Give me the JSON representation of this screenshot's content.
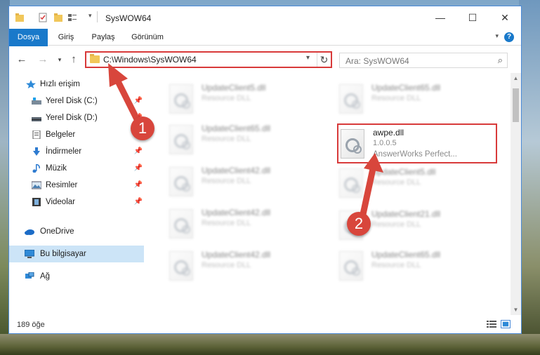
{
  "window": {
    "title": "SysWOW64",
    "minimize_icon": "minimize-icon",
    "maximize_icon": "maximize-icon",
    "close_icon": "close-icon"
  },
  "ribbon": {
    "tabs": [
      "Dosya",
      "Giriş",
      "Paylaş",
      "Görünüm"
    ],
    "help_label": "?"
  },
  "address_bar": {
    "path": "C:\\Windows\\SysWOW64",
    "search_placeholder": "Ara: SysWOW64"
  },
  "sidebar": {
    "items": [
      {
        "label": "Hızlı erişim",
        "icon": "star-icon"
      },
      {
        "label": "Yerel Disk (C:)",
        "icon": "drive-icon"
      },
      {
        "label": "Yerel Disk (D:)",
        "icon": "drive-icon"
      },
      {
        "label": "Belgeler",
        "icon": "documents-icon"
      },
      {
        "label": "İndirmeler",
        "icon": "download-icon"
      },
      {
        "label": "Müzik",
        "icon": "music-icon"
      },
      {
        "label": "Resimler",
        "icon": "pictures-icon"
      },
      {
        "label": "Videolar",
        "icon": "video-icon"
      },
      {
        "label": "OneDrive",
        "icon": "cloud-icon"
      },
      {
        "label": "Bu bilgisayar",
        "icon": "computer-icon"
      },
      {
        "label": "Ağ",
        "icon": "network-icon"
      }
    ]
  },
  "files": {
    "left": [
      {
        "name": "UpdateClient5.dll",
        "type": "Resource DLL"
      },
      {
        "name": "UpdateClient65.dll",
        "type": "Resource DLL"
      },
      {
        "name": "UpdateClient42.dll",
        "type": "Resource DLL"
      },
      {
        "name": "UpdateClient42.dll",
        "type": "Resource DLL"
      },
      {
        "name": "UpdateClient42.dll",
        "type": "Resource DLL"
      }
    ],
    "right": [
      {
        "name": "UpdateClient65.dll",
        "type": "Resource DLL"
      },
      {
        "name": "UpdateClient5.dll",
        "type": "Resource DLL"
      },
      {
        "name": "UpdateClient21.dll",
        "type": "Resource DLL"
      },
      {
        "name": "UpdateClient65.dll",
        "type": "Resource DLL"
      }
    ],
    "highlighted": {
      "name": "awpe.dll",
      "version": "1.0.0.5",
      "description": "AnswerWorks Perfect..."
    }
  },
  "annotations": {
    "step1": "1",
    "step2": "2",
    "color": "#d8463c"
  },
  "status": {
    "item_count": "189 öğe"
  }
}
